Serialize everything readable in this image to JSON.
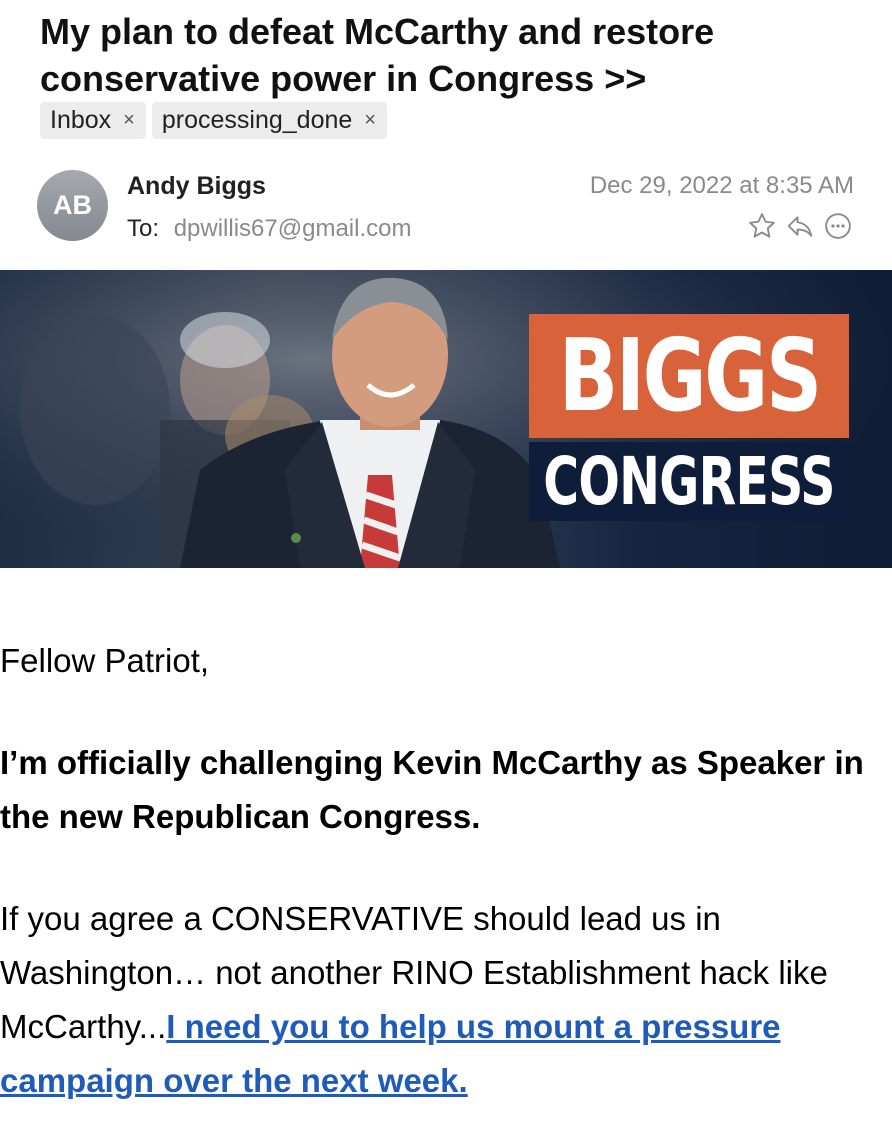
{
  "email": {
    "subject": "My plan to defeat McCarthy and restore conservative power in Congress >>",
    "tags": [
      {
        "label": "Inbox",
        "remove": "×"
      },
      {
        "label": "processing_done",
        "remove": "×"
      }
    ],
    "sender": {
      "initials": "AB",
      "name": "Andy Biggs",
      "to_label": "To:",
      "to_address": "dpwillis67@gmail.com"
    },
    "date": "Dec 29, 2022 at 8:35 AM",
    "actions": [
      "star-icon",
      "reply-icon",
      "more-icon"
    ]
  },
  "banner": {
    "logo_top": "BIGGS",
    "logo_bottom": "CONGRESS",
    "colors": {
      "orange": "#d8633a",
      "navy": "#0e1d3a"
    }
  },
  "body": {
    "greeting": "Fellow Patriot,",
    "bold_paragraph": "I’m officially challenging Kevin McCarthy as Speaker in the new Republican Congress.",
    "paragraph_start": "If you agree a CONSERVATIVE should lead us in Washington… not another RINO Establishment hack like McCarthy...",
    "link_text": "I need you to help us mount a pressure campaign over the next week."
  },
  "colors": {
    "link": "#1f5bb8",
    "meta_gray": "#8a8a8a",
    "tag_bg": "#ececec"
  }
}
